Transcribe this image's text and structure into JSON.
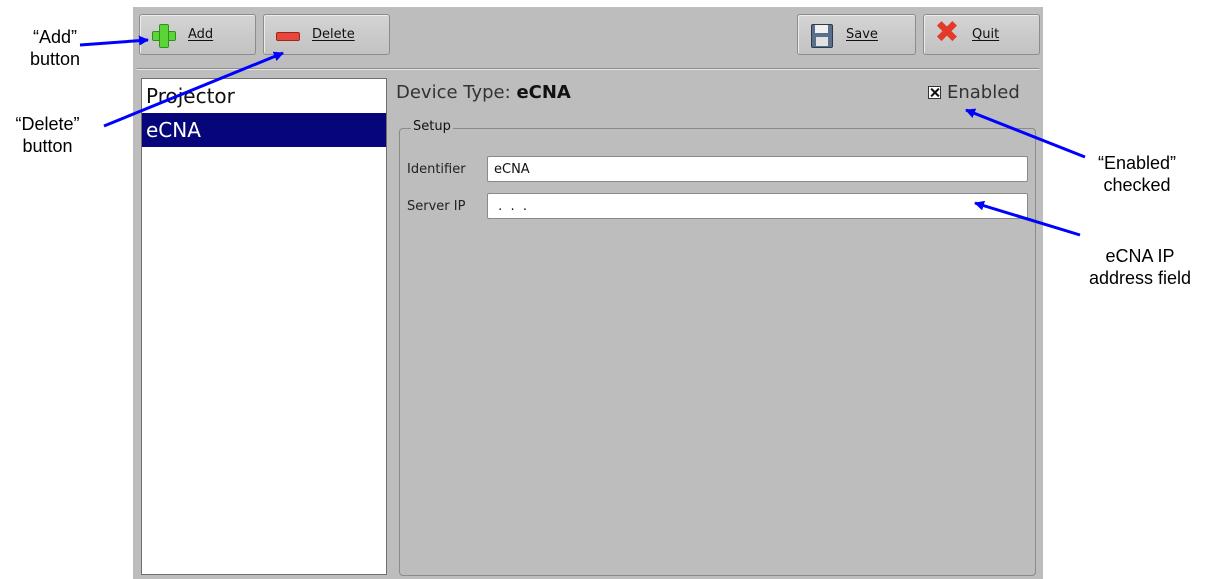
{
  "toolbar": {
    "add_label": "Add",
    "delete_label": "Delete",
    "save_label": "Save",
    "quit_label": "Quit"
  },
  "devices": [
    {
      "label": "Projector",
      "selected": false
    },
    {
      "label": "eCNA",
      "selected": true
    }
  ],
  "detail": {
    "device_type_label": "Device Type:",
    "device_type_value": "eCNA",
    "enabled_label": "Enabled",
    "enabled_checked": true,
    "group_title": "Setup",
    "identifier_label": "Identifier",
    "identifier_value": "eCNA",
    "server_ip_label": "Server IP",
    "server_ip_value": " .  .  ."
  },
  "annotations": {
    "add_button": {
      "line1": "“Add”",
      "line2": "button"
    },
    "delete_button": {
      "line1": "“Delete”",
      "line2": "button"
    },
    "enabled_checked": {
      "line1": "“Enabled”",
      "line2": "checked"
    },
    "ip_field": {
      "line1": "eCNA IP",
      "line2": "address field"
    }
  },
  "colors": {
    "window_bg": "#bdbdbd",
    "selection": "#06067a",
    "arrow": "#0000ff"
  },
  "icons": [
    "plus-icon",
    "minus-icon",
    "floppy-disk-icon",
    "close-x-icon",
    "checkbox-checked-icon"
  ]
}
